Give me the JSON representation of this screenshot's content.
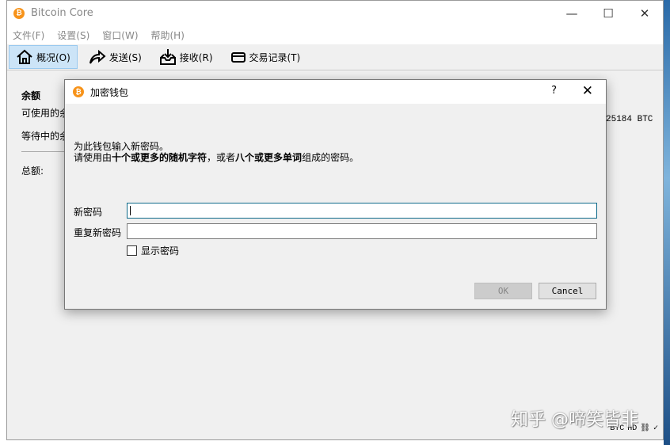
{
  "window": {
    "title": "Bitcoin Core",
    "menu": [
      "文件(F)",
      "设置(S)",
      "窗口(W)",
      "帮助(H)"
    ],
    "toolbar": [
      {
        "label": "概况(O)",
        "icon": "home-icon",
        "active": true
      },
      {
        "label": "发送(S)",
        "icon": "send-arrow-icon"
      },
      {
        "label": "接收(R)",
        "icon": "receive-inbox-icon"
      },
      {
        "label": "交易记录(T)",
        "icon": "card-icon"
      }
    ]
  },
  "overview": {
    "heading": "余额",
    "available": "可使用的余",
    "pending": "等待中的余",
    "total": "总额:",
    "balance_fragment": "25184 BTC"
  },
  "dialog": {
    "title": "加密钱包",
    "help": "?",
    "close": "✕",
    "line1": "为此钱包输入新密码。",
    "line2_parts": [
      "请使用由",
      "十个或更多的随机字符",
      "，或者",
      "八个或更多单词",
      "组成的密码。"
    ],
    "new_password_label": "新密码",
    "new_password_value": "",
    "repeat_password_label": "重复新密码",
    "repeat_password_value": "",
    "show_password_label": "显示密码",
    "show_password_checked": false,
    "ok": "OK",
    "cancel": "Cancel"
  },
  "status": {
    "unit": "BTC",
    "hd": "HD"
  },
  "watermark": "知乎 @啼笑皆非"
}
